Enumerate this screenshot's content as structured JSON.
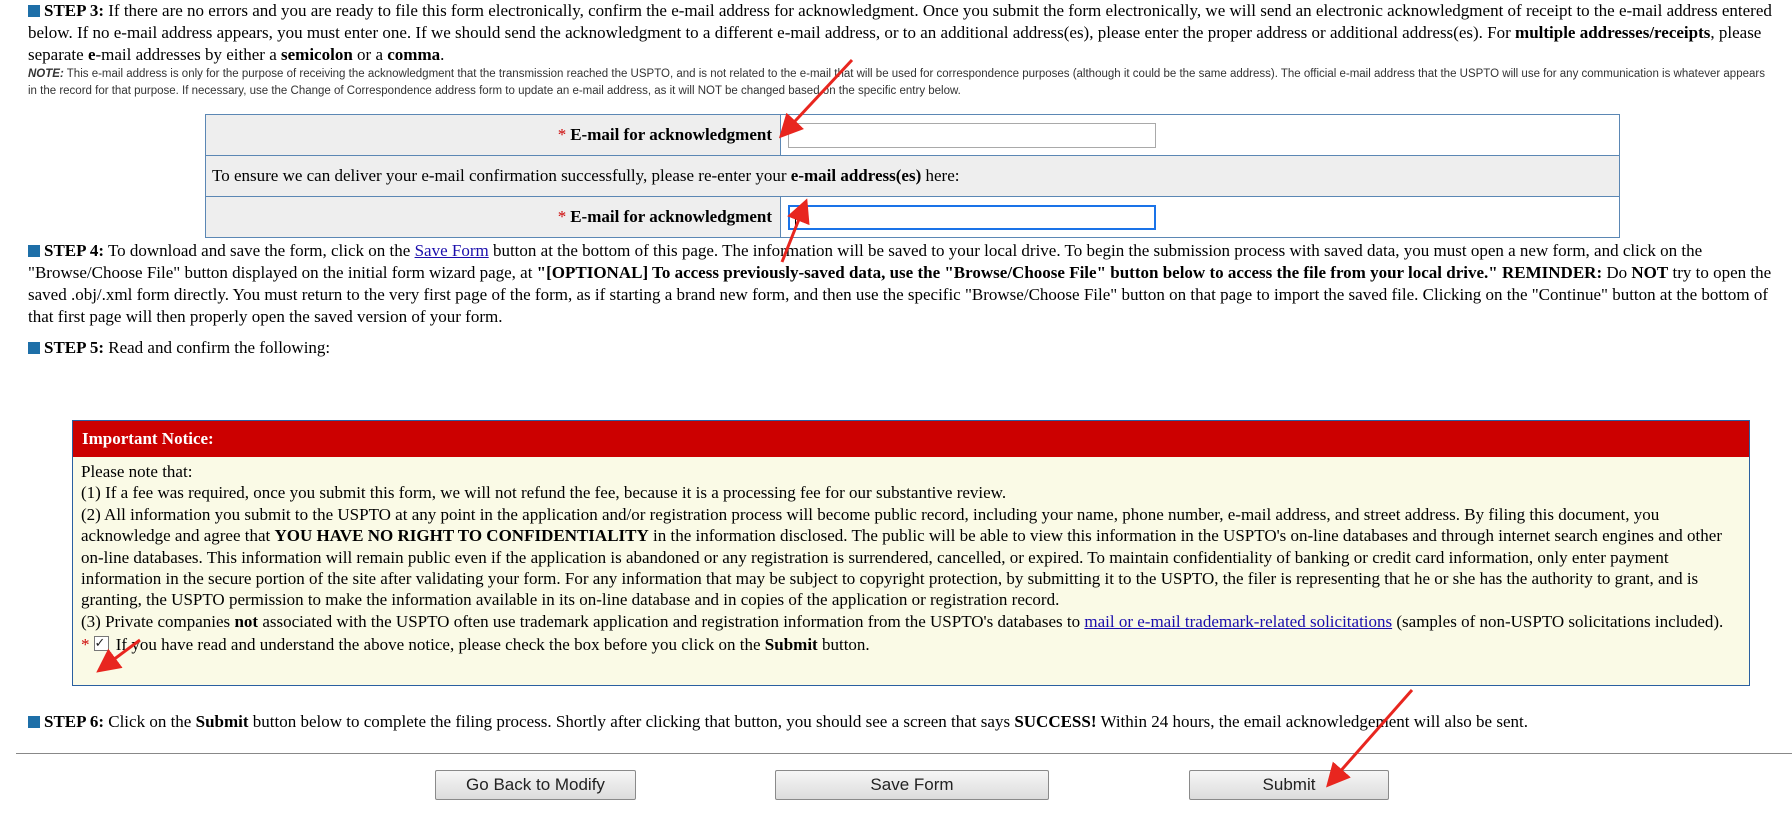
{
  "step3": {
    "label": "STEP 3:",
    "text": " If there are no errors and you are ready to file this form electronically, confirm the e-mail address for acknowledgment. Once you submit the form electronically, we will send an electronic acknowledgment of receipt to the e-mail address entered below. If no e-mail address appears, you must enter one. If we should send the acknowledgment to a different e-mail address, or to an additional address(es), please enter the proper address or additional address(es). For ",
    "bold1": "multiple addresses/receipts",
    "text2": ", please separate ",
    "bold2": "e",
    "text3": "-mail addresses by either a ",
    "bold3": "semicolon",
    "text4": " or a ",
    "bold4": "comma",
    "text5": ".",
    "note_label": "NOTE:",
    "note_text": " This e-mail address is only for the purpose of receiving the acknowledgment that the transmission reached the USPTO, and is not related to the e-mail that will be used for correspondence purposes (although it could be the same address). The official e-mail address that the USPTO will use for any communication is whatever appears in the record for that purpose. If necessary, use the Change of Correspondence address form to update an e-mail address, as it will NOT be changed based on the specific entry below."
  },
  "email_table": {
    "required_mark": "*",
    "field1_label": "E-mail for acknowledgment",
    "field1_value": "",
    "confirm_text_a": "To ensure we can deliver your e-mail confirmation successfully, please re-enter your ",
    "confirm_text_bold": "e-mail address(es)",
    "confirm_text_b": " here:",
    "field2_label": "E-mail for acknowledgment",
    "field2_value": ""
  },
  "step4": {
    "label": "STEP 4:",
    "text1": " To download and save the form, click on the ",
    "link": "Save Form",
    "text2": " button at the bottom of this page. The information will be saved to your local drive. To begin the submission process with saved data, you must open a new form, and click on the \"Browse/Choose File\" button displayed on the initial form wizard page, at ",
    "bold1": "\"[OPTIONAL] To access previously-saved data, use the \"Browse/Choose File\" button below to access the file from your local drive.\"",
    "text3": " ",
    "bold2": "REMINDER:",
    "text4": " Do ",
    "bold3": "NOT",
    "text5": " try to open the saved .obj/.xml form directly. You must return to the very first page of the form, as if starting a brand new form, and then use the specific \"Browse/Choose File\" button on that page to import the saved file. Clicking on the \"Continue\" button at the bottom of that first page will then properly open the saved version of your form."
  },
  "step5": {
    "label": "STEP 5:",
    "text": " Read and confirm the following:"
  },
  "notice": {
    "title": "Important Notice:",
    "intro": "Please note that:",
    "p1": "(1) If a fee was required, once you submit this form, we will not refund the fee, because it is a processing fee for our substantive review.",
    "p2a": "(2) All information you submit to the USPTO at any point in the application and/or registration process will become public record, including your name, phone number, e-mail address, and street address. By filing this document, you acknowledge and agree that ",
    "p2bold": "YOU HAVE NO RIGHT TO CONFIDENTIALITY",
    "p2b": " in the information disclosed. The public will be able to view this information in the USPTO's on-line databases and through internet search engines and other on-line databases. This information will remain public even if the application is abandoned or any registration is surrendered, cancelled, or expired. To maintain confidentiality of banking or credit card information, only enter payment information in the secure portion of the site after validating your form. For any information that may be subject to copyright protection, by submitting it to the USPTO, the filer is representing that he or she has the authority to grant, and is granting, the USPTO permission to make the information available in its on-line database and in copies of the application or registration record.",
    "p3a": "(3) Private companies ",
    "p3bold": "not",
    "p3b": " associated with the USPTO often use trademark application and registration information from the USPTO's databases to ",
    "p3link": "mail or e-mail trademark-related solicitations",
    "p3c": " (samples of non-USPTO solicitations included).",
    "required_mark": "*",
    "checkbox_checked": true,
    "confirm_a": " If you have read and understand the above notice, please check the box before you click on the ",
    "confirm_bold": "Submit",
    "confirm_b": " button."
  },
  "step6": {
    "label": "STEP 6:",
    "text1": " Click on the ",
    "bold1": "Submit",
    "text2": " button below to complete the filing process. Shortly after clicking that button, you should see a screen that says ",
    "bold2": "SUCCESS!",
    "text3": " Within 24 hours, the email acknowledgement will also be sent."
  },
  "buttons": {
    "back": "Go Back to Modify",
    "save": "Save Form",
    "submit": "Submit"
  },
  "colors": {
    "accent_blue": "#1e6fa8",
    "notice_header_red": "#cc0000",
    "annotation_arrow_red": "#e8261f",
    "notice_background": "#fafae6"
  }
}
